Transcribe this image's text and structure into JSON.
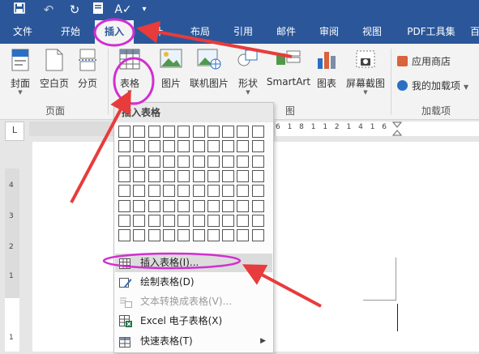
{
  "qat": {
    "save_icon": "save-icon",
    "undo_icon": "undo-icon",
    "redo_icon": "repeat-icon",
    "more_icon": "more-icon"
  },
  "tabs": [
    "文件",
    "开始",
    "插入",
    "计",
    "布局",
    "引用",
    "邮件",
    "审阅",
    "视图",
    "PDF工具集",
    "百"
  ],
  "active_tab": "插入",
  "ribbon": {
    "pages_group": {
      "label": "页面",
      "cover": "封面",
      "blank": "空白页",
      "break": "分页"
    },
    "table_button": "表格",
    "illustrations": {
      "picture": "图片",
      "online_picture": "联机图片",
      "shapes": "形状",
      "smartart": "SmartArt",
      "chart": "图表",
      "screenshot": "屏幕截图",
      "group_label": "图"
    },
    "addins_group": {
      "label": "加载项",
      "store": "应用商店",
      "my_addins": "我的加载项"
    }
  },
  "ruler": {
    "corner": "L",
    "h_ticks": "6 1 8 1 1 2 1 4 1 6",
    "v_ticks": [
      "4",
      "3",
      "2",
      "1",
      "1"
    ]
  },
  "dropdown": {
    "title": "插入表格",
    "grid": {
      "columns": 10,
      "rows": 8
    },
    "items": [
      {
        "label": "插入表格(I)...",
        "icon": "table-icon",
        "highlighted": true,
        "disabled": false
      },
      {
        "label": "绘制表格(D)",
        "icon": "pencil-table-icon",
        "highlighted": false,
        "disabled": false
      },
      {
        "label": "文本转换成表格(V)...",
        "icon": "text-to-table-icon",
        "highlighted": false,
        "disabled": true
      },
      {
        "label": "Excel 电子表格(X)",
        "icon": "excel-icon",
        "highlighted": false,
        "disabled": false
      },
      {
        "label": "快速表格(T)",
        "icon": "quick-table-icon",
        "highlighted": false,
        "disabled": false,
        "submenu": true
      }
    ]
  },
  "annotation_colors": {
    "arrow": "#e83b3b",
    "circle": "#d12fd0",
    "ribbon_blue": "#2b579a"
  }
}
